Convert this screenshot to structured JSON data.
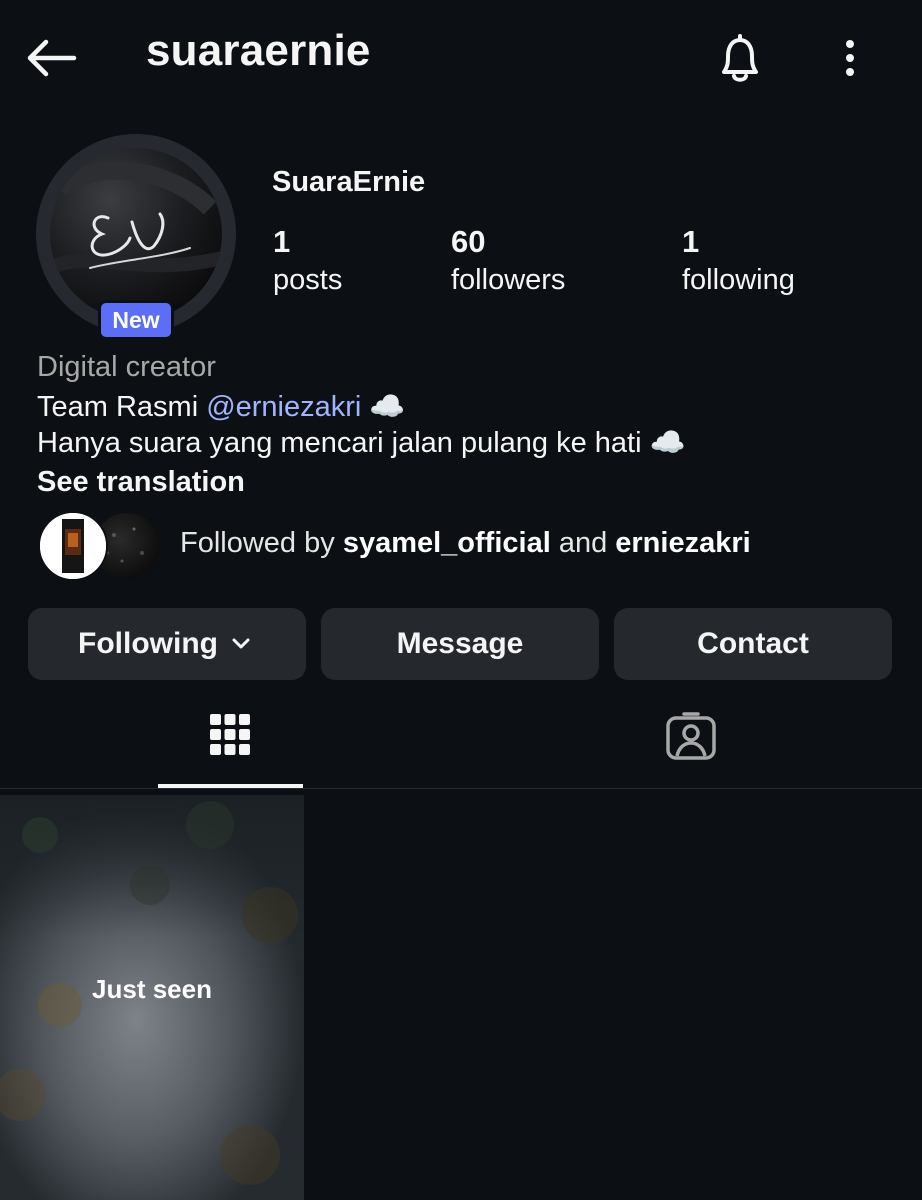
{
  "header": {
    "username": "suaraernie",
    "back_icon": "back-arrow-icon",
    "bell_icon": "bell-icon",
    "more_icon": "more-vertical-icon"
  },
  "profile": {
    "new_badge": "New",
    "display_name": "SuaraErnie",
    "stats": [
      {
        "value": "1",
        "label": "posts"
      },
      {
        "value": "60",
        "label": "followers"
      },
      {
        "value": "1",
        "label": "following"
      }
    ],
    "category": "Digital creator",
    "bio_line1_prefix": "Team Rasmi ",
    "bio_line1_mention": "@erniezakri",
    "bio_line1_suffix": " ☁️",
    "bio_line2": "Hanya suara yang mencari jalan pulang ke hati ☁️",
    "see_translation": "See translation",
    "followed_by_prefix": "Followed by ",
    "followed_by_user1": "syamel_official",
    "followed_by_and": " and ",
    "followed_by_user2": "erniezakri"
  },
  "actions": {
    "following_label": "Following",
    "message_label": "Message",
    "contact_label": "Contact"
  },
  "tabs": [
    {
      "name": "posts-grid",
      "icon": "grid-icon",
      "selected": true
    },
    {
      "name": "tagged",
      "icon": "tagged-person-icon",
      "selected": false
    }
  ],
  "posts": [
    {
      "overlay_text": "Just seen"
    }
  ],
  "colors": {
    "background": "#0c1014",
    "button_bg": "#25292e",
    "badge_blue": "#5b6ef5",
    "mention_blue": "#a1b4ff",
    "secondary_text": "#a8a8a8"
  }
}
